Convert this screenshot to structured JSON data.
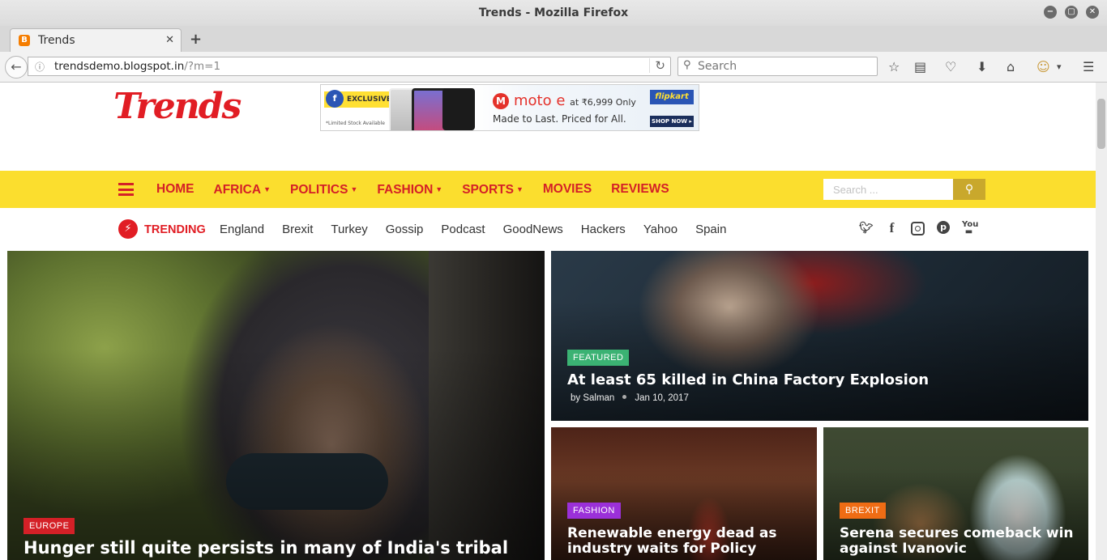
{
  "window": {
    "title": "Trends - Mozilla Firefox",
    "controls": [
      "−",
      "▢",
      "✕"
    ]
  },
  "tab": {
    "title": "Trends",
    "favicon": "B",
    "close": "✕",
    "new_tab": "+"
  },
  "toolbar": {
    "url_host": "trendsdemo.blogspot.in",
    "url_path": "/?m=1",
    "search_placeholder": "Search",
    "icons": [
      "back-icon",
      "info-icon",
      "reload-icon",
      "bookmark-star-icon",
      "reading-list-icon",
      "pocket-icon",
      "download-icon",
      "home-icon",
      "addon-icon",
      "menu-icon"
    ]
  },
  "site": {
    "logo": "Trends",
    "ad": {
      "exclusive": "EXCLUSIVE",
      "fineprint": "*Limited Stock Available",
      "headline": "moto e",
      "price": "at ₹6,999 Only",
      "tagline": "Made to Last. Priced for All.",
      "brand": "flipkart",
      "cta": "SHOP NOW ▸"
    },
    "nav": [
      {
        "label": "HOME",
        "dropdown": false
      },
      {
        "label": "AFRICA",
        "dropdown": true
      },
      {
        "label": "POLITICS",
        "dropdown": true
      },
      {
        "label": "FASHION",
        "dropdown": true
      },
      {
        "label": "SPORTS",
        "dropdown": true
      },
      {
        "label": "MOVIES",
        "dropdown": false
      },
      {
        "label": "REVIEWS",
        "dropdown": false
      }
    ],
    "search_placeholder": "Search ...",
    "trending_label": "TRENDING",
    "trending_tags": [
      "England",
      "Brexit",
      "Turkey",
      "Gossip",
      "Podcast",
      "GoodNews",
      "Hackers",
      "Yahoo",
      "Spain"
    ],
    "social": [
      "twitter-icon",
      "facebook-icon",
      "instagram-icon",
      "pinterest-icon",
      "youtube-icon"
    ]
  },
  "posts": {
    "big": {
      "category": "EUROPE",
      "category_color": "#d42027",
      "title": "Hunger still quite persists in many of India's tribal"
    },
    "feature": {
      "category": "FEATURED",
      "category_color": "#3bb273",
      "title": "At least 65 killed in China Factory Explosion",
      "author": "by Salman",
      "date": "Jan 10, 2017"
    },
    "small1": {
      "category": "FASHION",
      "category_color": "#9b30d9",
      "title": "Renewable energy dead as industry waits for Policy"
    },
    "small2": {
      "category": "BREXIT",
      "category_color": "#ef6c14",
      "title": "Serena secures comeback win against Ivanovic"
    }
  }
}
